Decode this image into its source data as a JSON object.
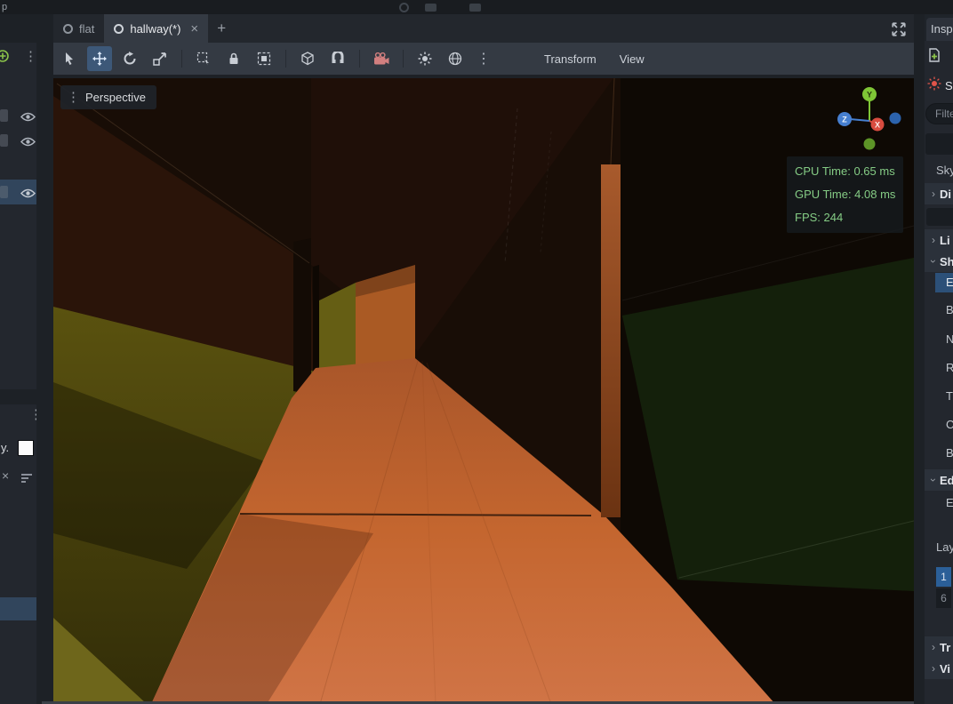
{
  "topbar": {
    "fragment": "p"
  },
  "scene_tabs": {
    "tabs": [
      {
        "label": "flat",
        "active": false
      },
      {
        "label": "hallway(*)",
        "active": true
      }
    ],
    "close_glyph": "×",
    "add_glyph": "+"
  },
  "toolbar": {
    "tools": [
      {
        "name": "select",
        "active": false
      },
      {
        "name": "move",
        "active": true
      },
      {
        "name": "rotate",
        "active": false
      },
      {
        "name": "scale",
        "active": false
      },
      {
        "name": "box-select",
        "active": false
      },
      {
        "name": "lock",
        "active": false
      },
      {
        "name": "group",
        "active": false
      },
      {
        "name": "local-space",
        "active": false
      },
      {
        "name": "snap",
        "active": false
      },
      {
        "name": "camera-preview",
        "active": false
      },
      {
        "name": "sun",
        "active": false
      },
      {
        "name": "environment",
        "active": false
      }
    ],
    "more_glyph": "⋮",
    "menus": [
      {
        "label": "Transform"
      },
      {
        "label": "View"
      }
    ]
  },
  "viewport": {
    "view_label": "Perspective",
    "view_menu_glyph": "⋮",
    "stats": {
      "cpu": "CPU Time: 0.65 ms",
      "gpu": "GPU Time: 4.08 ms",
      "fps": "FPS: 244"
    },
    "gizmo": {
      "x": "X",
      "y": "Y",
      "z": "Z"
    }
  },
  "left_dock": {
    "top_panel": {
      "menu_glyph": "⋮"
    },
    "bottom_panel": {
      "menu_glyph": "⋮",
      "row1_label": "y.",
      "row2_label": "×"
    }
  },
  "inspector": {
    "tab_label": "Insp",
    "node_label": "S",
    "filter_placeholder": "Filte",
    "section_arrow": "›",
    "rows": [
      {
        "label": "Sky",
        "kind": "prop"
      },
      {
        "label": "Di",
        "kind": "section"
      },
      {
        "label": "",
        "kind": "input"
      },
      {
        "label": "Li",
        "kind": "section"
      },
      {
        "label": "Sh",
        "kind": "section-open"
      },
      {
        "label": "E",
        "kind": "prop-selected"
      },
      {
        "label": "B",
        "kind": "prop-child"
      },
      {
        "label": "N",
        "kind": "prop-child"
      },
      {
        "label": "R",
        "kind": "prop-child"
      },
      {
        "label": "T",
        "kind": "prop-child"
      },
      {
        "label": "C",
        "kind": "prop-child"
      },
      {
        "label": "B",
        "kind": "prop-child"
      },
      {
        "label": "Ed",
        "kind": "section-open"
      },
      {
        "label": "E",
        "kind": "prop-child"
      },
      {
        "label": "Lay",
        "kind": "prop"
      },
      {
        "label": "1",
        "kind": "layer-on"
      },
      {
        "label": "6",
        "kind": "layer-off"
      },
      {
        "label": "Tr",
        "kind": "section"
      },
      {
        "label": "Vi",
        "kind": "section"
      }
    ]
  },
  "icons": {
    "select-tool": "cursor-arrow",
    "move-tool": "cross-arrows",
    "rotate-tool": "circular-arrow",
    "scale-tool": "box-diagonal-arrow",
    "box-select-tool": "dashed-box-cursor",
    "lock": "padlock",
    "group": "dashed-box-solid-square",
    "local-space": "cube",
    "snap": "magnet",
    "camera-preview": "film-camera",
    "sun": "sun-rays",
    "environment": "globe",
    "more": "⋮",
    "expand": "corner-arrows",
    "eye": "eye-outline",
    "close": "×",
    "add": "+",
    "new-resource": "paper-plus",
    "directional-light": "red-sun"
  },
  "colors": {
    "selection_blue": "#31455c",
    "inspector_highlight": "#2c5078",
    "layer_blue": "#2b5f98",
    "stats_green": "#85cc85",
    "floor_orange": "#c96a38",
    "wall_olive": "#5a520f",
    "toolbar_active": "#3d5878"
  }
}
